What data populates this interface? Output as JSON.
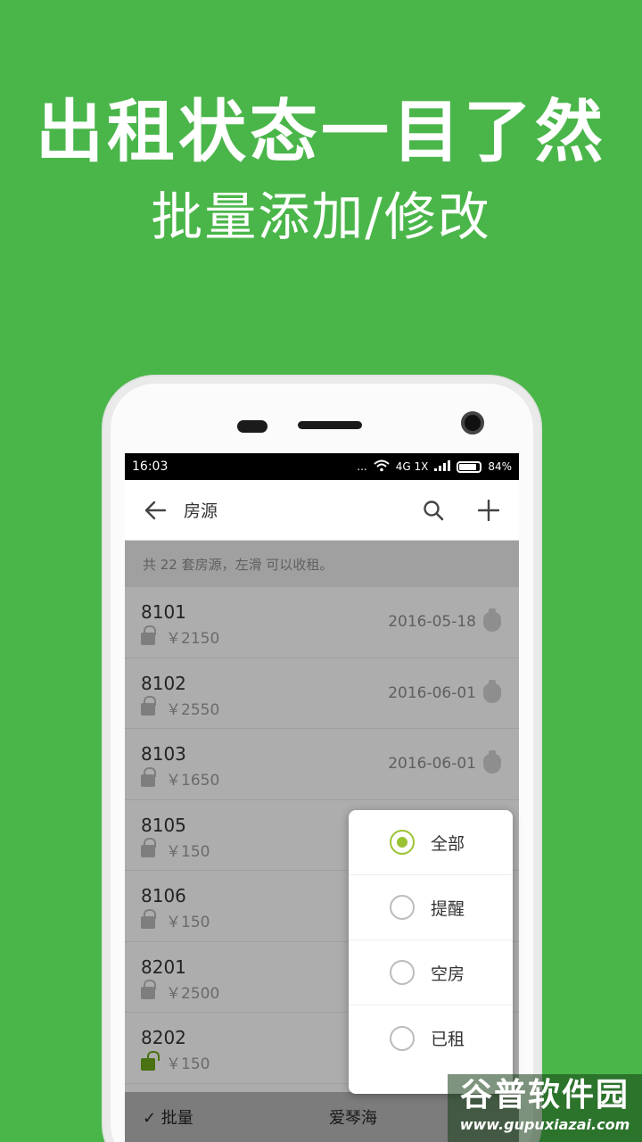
{
  "promo": {
    "headline": "出租状态一目了然",
    "subline": "批量添加/修改"
  },
  "status_bar": {
    "time": "16:03",
    "dots": "...",
    "network": "4G 1X",
    "battery": "84%"
  },
  "app_bar": {
    "title": "房源",
    "back_icon": "arrow-left-icon",
    "search_icon": "search-icon",
    "add_icon": "plus-icon"
  },
  "info": "共 22 套房源，左滑 可以收租。",
  "rooms": [
    {
      "room": "8101",
      "price": "￥2150",
      "date": "2016-05-18",
      "locked": true
    },
    {
      "room": "8102",
      "price": "￥2550",
      "date": "2016-06-01",
      "locked": true
    },
    {
      "room": "8103",
      "price": "￥1650",
      "date": "2016-06-01",
      "locked": true
    },
    {
      "room": "8105",
      "price": "￥150",
      "date": "",
      "locked": true
    },
    {
      "room": "8106",
      "price": "￥150",
      "date": "",
      "locked": true
    },
    {
      "room": "8201",
      "price": "￥2500",
      "date": "",
      "locked": true
    },
    {
      "room": "8202",
      "price": "￥150",
      "date": "",
      "locked": false
    }
  ],
  "filter_popup": {
    "options": [
      {
        "label": "全部",
        "checked": true
      },
      {
        "label": "提醒",
        "checked": false
      },
      {
        "label": "空房",
        "checked": false
      },
      {
        "label": "已租",
        "checked": false
      }
    ]
  },
  "bottom_bar": {
    "batch_label": "✓ 批量",
    "owner_label": "爱琴海"
  },
  "watermark": {
    "title": "谷普软件园",
    "url": "www.gupuxiazai.com"
  },
  "colors": {
    "background": "#4ab64a",
    "accent": "#9bc232",
    "unlocked": "#6aa31a"
  }
}
